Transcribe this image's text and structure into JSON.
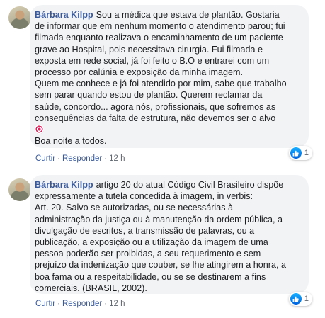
{
  "comments": [
    {
      "author": "Bárbara Kilpp",
      "text_lines": [
        "Sou a médica que estava de plantão. Gostaria",
        "de informar que em nenhum momento o atendimento parou; fui",
        "filmada enquanto realizava o encaminhamento de um paciente",
        "grave ao Hospital, pois necessitava cirurgia. Fui filmada e",
        "exposta em rede social, já foi feito o B.O e entrarei com um",
        "processo por calúnia e exposição da minha imagem.",
        "Quem me conhece e já foi atendido por mim, sabe que trabalho",
        "sem parar quando estou de plantão. Querem reclamar da",
        "saúde, concordo... agora nós, profissionais, que sofremos as",
        "consequências da falta de estrutura, não devemos ser o alvo"
      ],
      "emoji_icon": "direct-hit-target-icon",
      "closing": "Boa noite a todos.",
      "actions": {
        "like": "Curtir",
        "reply": "Responder",
        "time": "12 h"
      },
      "reaction_count": "1"
    },
    {
      "author": "Bárbara Kilpp",
      "text_lines": [
        "artigo 20 do atual Código Civil Brasileiro dispõe",
        "expressamente a tutela concedida à imagem, in verbis:",
        "Art. 20. Salvo se autorizadas, ou se necessárias à",
        "administração da justiça ou à manutenção da ordem pública, a",
        "divulgação de escritos, a transmissão de palavras, ou a",
        "publicação, a exposição ou a utilização da imagem de uma",
        "pessoa poderão ser proibidas, a seu requerimento e sem",
        "prejuízo da indenização que couber, se lhe atingirem a honra, a",
        "boa fama ou a respeitabilidade, ou se se destinarem a fins",
        "comerciais. (BRASIL, 2002)."
      ],
      "actions": {
        "like": "Curtir",
        "reply": "Responder",
        "time": "12 h"
      },
      "reaction_count": "1"
    }
  ],
  "colors": {
    "author": "#385898",
    "bubble": "#f2f3f5",
    "like_blue": "#1877f2"
  }
}
